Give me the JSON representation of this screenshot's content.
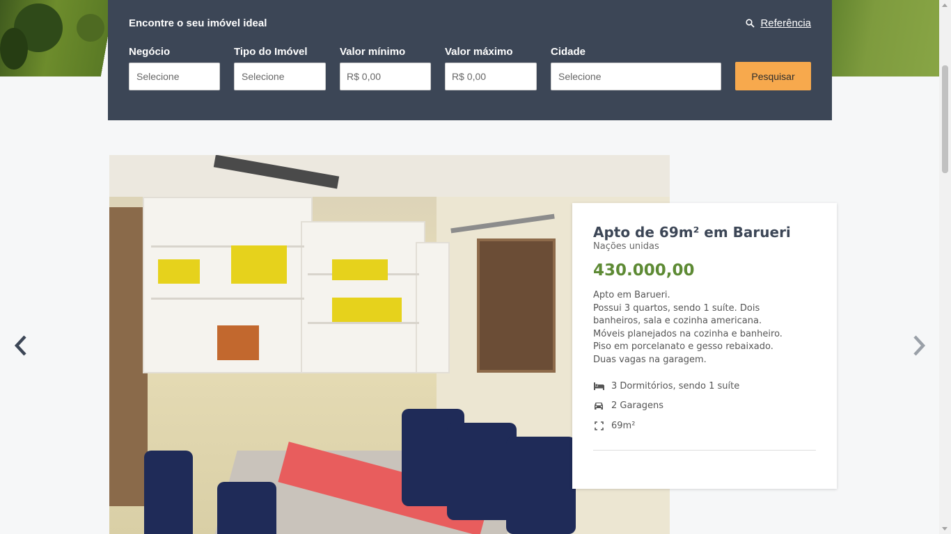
{
  "search": {
    "title": "Encontre o seu imóvel ideal",
    "reference_label": "Referência",
    "fields": [
      {
        "label": "Negócio",
        "placeholder": "Selecione"
      },
      {
        "label": "Tipo do Imóvel",
        "placeholder": "Selecione"
      },
      {
        "label": "Valor mínimo",
        "placeholder": "R$ 0,00"
      },
      {
        "label": "Valor máximo",
        "placeholder": "R$ 0,00"
      },
      {
        "label": "Cidade",
        "placeholder": "Selecione"
      }
    ],
    "button_label": "Pesquisar"
  },
  "listing": {
    "title": "Apto de 69m² em Barueri",
    "neighborhood": "Nações unidas",
    "price": "430.000,00",
    "description_lines": [
      "Apto em Barueri.",
      "Possui 3 quartos, sendo 1 suíte. Dois",
      "banheiros, sala e cozinha americana.",
      "Móveis planejados na cozinha e banheiro.",
      "Piso em porcelanato e gesso rebaixado.",
      "Duas vagas na garagem."
    ],
    "features": [
      {
        "icon": "bed-icon",
        "text": "3 Dormitórios, sendo 1 suíte"
      },
      {
        "icon": "car-icon",
        "text": "2 Garagens"
      },
      {
        "icon": "expand-icon",
        "text": "69m²"
      }
    ]
  },
  "colors": {
    "panel": "#3c4656",
    "accent_button": "#f7a94d",
    "price": "#5d8a34"
  }
}
